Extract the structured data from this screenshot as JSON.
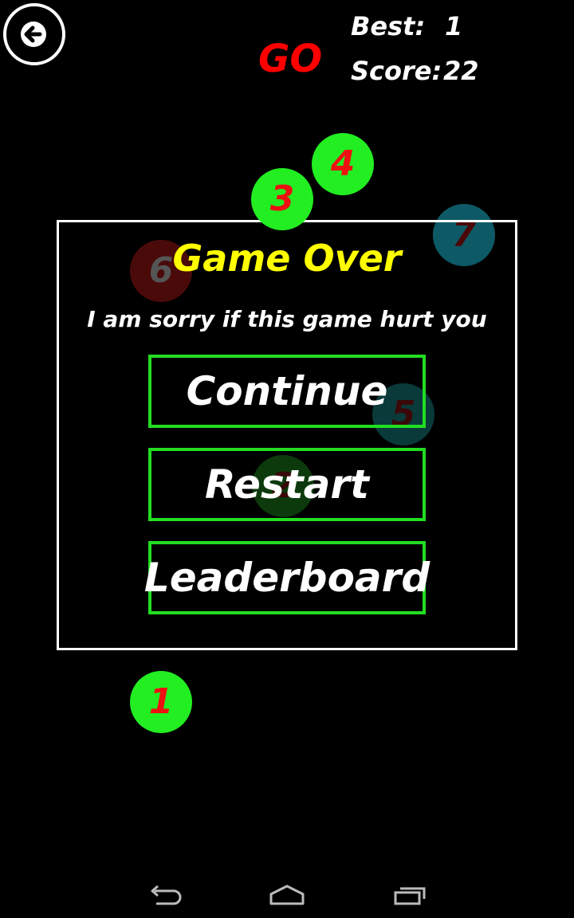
{
  "hud": {
    "go_label": "GO",
    "best_label": "Best:",
    "best_value": "1",
    "score_label": "Score:",
    "score_value": "22"
  },
  "balls": [
    {
      "label": "1",
      "color": "#22ee22",
      "text_color": "#ee1111",
      "faded": false
    },
    {
      "label": "2",
      "color": "#0d3a0d",
      "text_color": "#3a0808",
      "faded": true
    },
    {
      "label": "3",
      "color": "#22ee22",
      "text_color": "#ee1111",
      "faded": false
    },
    {
      "label": "4",
      "color": "#22ee22",
      "text_color": "#ee1111",
      "faded": false
    },
    {
      "label": "5",
      "color": "#0a3a3a",
      "text_color": "#3a0808",
      "faded": true
    },
    {
      "label": "6",
      "color": "#4a0a0a",
      "text_color": "#555555",
      "faded": true
    },
    {
      "label": "7",
      "color": "#0d5a66",
      "text_color": "#4a0808",
      "faded": true
    }
  ],
  "dialog": {
    "title": "Game Over",
    "subtitle": "I am sorry if this game hurt you",
    "continue_label": "Continue",
    "restart_label": "Restart",
    "leaderboard_label": "Leaderboard"
  },
  "colors": {
    "background": "#000000",
    "go": "#ff0000",
    "title": "#ffff00",
    "button_border": "#22dd22",
    "ball_green": "#22ee22",
    "ball_number": "#ee1111",
    "ball_cyan": "#00e5ee"
  },
  "icons": {
    "back": "arrow-left-icon",
    "nav_back": "nav-back-icon",
    "nav_home": "nav-home-icon",
    "nav_recent": "nav-recent-apps-icon"
  }
}
